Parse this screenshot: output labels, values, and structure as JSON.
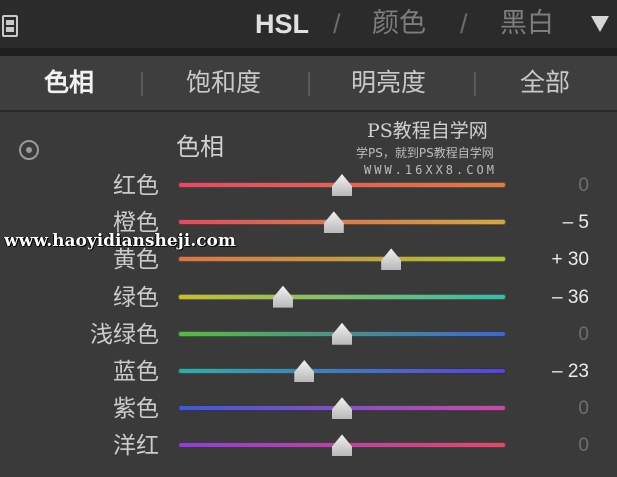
{
  "header": {
    "modes": [
      "HSL",
      "颜色",
      "黑白"
    ],
    "separator": "/"
  },
  "tabs": [
    {
      "label": "色相",
      "active": true
    },
    {
      "label": "饱和度",
      "active": false
    },
    {
      "label": "明亮度",
      "active": false
    },
    {
      "label": "全部",
      "active": false
    }
  ],
  "section": {
    "title": "色相"
  },
  "sliders": [
    {
      "label": "红色",
      "value": 0,
      "display": "0",
      "gradient": [
        "#d6506a",
        "#d67f4c"
      ]
    },
    {
      "label": "橙色",
      "value": -5,
      "display": "– 5",
      "gradient": [
        "#d45060",
        "#cfa94a"
      ]
    },
    {
      "label": "黄色",
      "value": 30,
      "display": "+ 30",
      "gradient": [
        "#d6774e",
        "#a9c444"
      ]
    },
    {
      "label": "绿色",
      "value": -36,
      "display": "– 36",
      "gradient": [
        "#c7bd40",
        "#3fb8a8"
      ]
    },
    {
      "label": "浅绿色",
      "value": 0,
      "display": "0",
      "gradient": [
        "#5bb84a",
        "#4466c8"
      ]
    },
    {
      "label": "蓝色",
      "value": -23,
      "display": "– 23",
      "gradient": [
        "#3aa9a0",
        "#5b46c4"
      ]
    },
    {
      "label": "紫色",
      "value": 0,
      "display": "0",
      "gradient": [
        "#4459cc",
        "#c04fa4"
      ]
    },
    {
      "label": "洋红",
      "value": 0,
      "display": "0",
      "gradient": [
        "#8847c4",
        "#d4506c"
      ]
    }
  ],
  "watermarks": {
    "title": "PS教程自学网",
    "subtitle": "学PS，就到PS教程自学网",
    "url": "WWW.16XX8.COM",
    "site": "www.haoyidiansheji.com"
  }
}
